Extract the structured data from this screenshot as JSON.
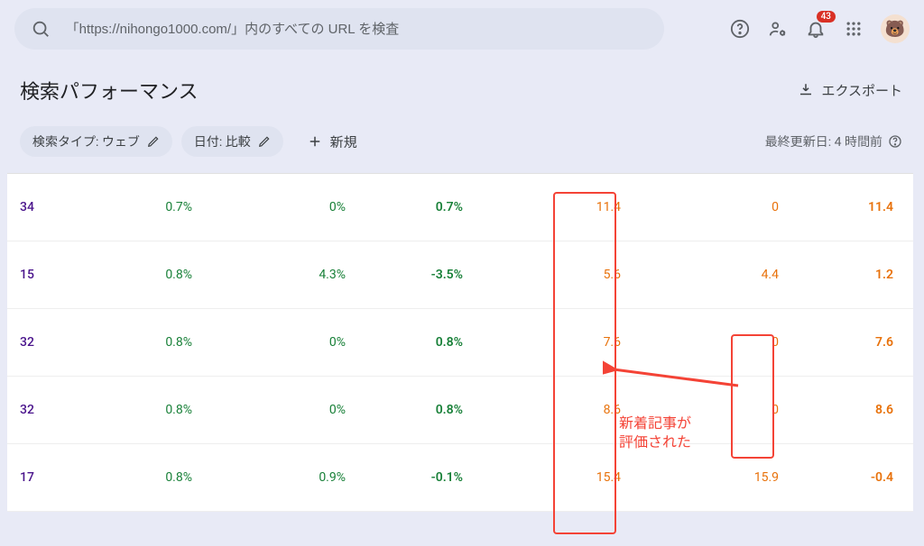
{
  "search": {
    "placeholder": "「https://nihongo1000.com/」内のすべての URL を検査"
  },
  "notifications": {
    "count": "43"
  },
  "header": {
    "title": "検索パフォーマンス",
    "export_label": "エクスポート"
  },
  "chips": {
    "search_type_label": "検索タイプ: ウェブ",
    "date_label": "日付: 比較",
    "new_label": "新規"
  },
  "last_updated": {
    "text": "最終更新日: 4 時間前"
  },
  "rows": [
    {
      "c0": "34",
      "c1": "0.7%",
      "c2": "0%",
      "c3": "0.7%",
      "c4": "11.4",
      "c5": "0",
      "c6": "11.4"
    },
    {
      "c0": "15",
      "c1": "0.8%",
      "c2": "4.3%",
      "c3": "-3.5%",
      "c4": "5.6",
      "c5": "4.4",
      "c6": "1.2"
    },
    {
      "c0": "32",
      "c1": "0.8%",
      "c2": "0%",
      "c3": "0.8%",
      "c4": "7.6",
      "c5": "0",
      "c6": "7.6"
    },
    {
      "c0": "32",
      "c1": "0.8%",
      "c2": "0%",
      "c3": "0.8%",
      "c4": "8.6",
      "c5": "0",
      "c6": "8.6"
    },
    {
      "c0": "17",
      "c1": "0.8%",
      "c2": "0.9%",
      "c3": "-0.1%",
      "c4": "15.4",
      "c5": "15.9",
      "c6": "-0.4"
    }
  ],
  "annotation": {
    "text": "新着記事が\n評価された"
  },
  "chart_data": {
    "type": "table",
    "note": "Google Search Console performance table (partial view, compared metrics)",
    "rows": [
      {
        "clicks_diff": 34,
        "ctr_a": 0.7,
        "ctr_b": 0.0,
        "ctr_diff": 0.7,
        "pos_a": 11.4,
        "pos_b": 0,
        "pos_diff": 11.4
      },
      {
        "clicks_diff": 15,
        "ctr_a": 0.8,
        "ctr_b": 4.3,
        "ctr_diff": -3.5,
        "pos_a": 5.6,
        "pos_b": 4.4,
        "pos_diff": 1.2
      },
      {
        "clicks_diff": 32,
        "ctr_a": 0.8,
        "ctr_b": 0.0,
        "ctr_diff": 0.8,
        "pos_a": 7.6,
        "pos_b": 0,
        "pos_diff": 7.6
      },
      {
        "clicks_diff": 32,
        "ctr_a": 0.8,
        "ctr_b": 0.0,
        "ctr_diff": 0.8,
        "pos_a": 8.6,
        "pos_b": 0,
        "pos_diff": 8.6
      },
      {
        "clicks_diff": 17,
        "ctr_a": 0.8,
        "ctr_b": 0.9,
        "ctr_diff": -0.1,
        "pos_a": 15.4,
        "pos_b": 15.9,
        "pos_diff": -0.4
      }
    ]
  }
}
